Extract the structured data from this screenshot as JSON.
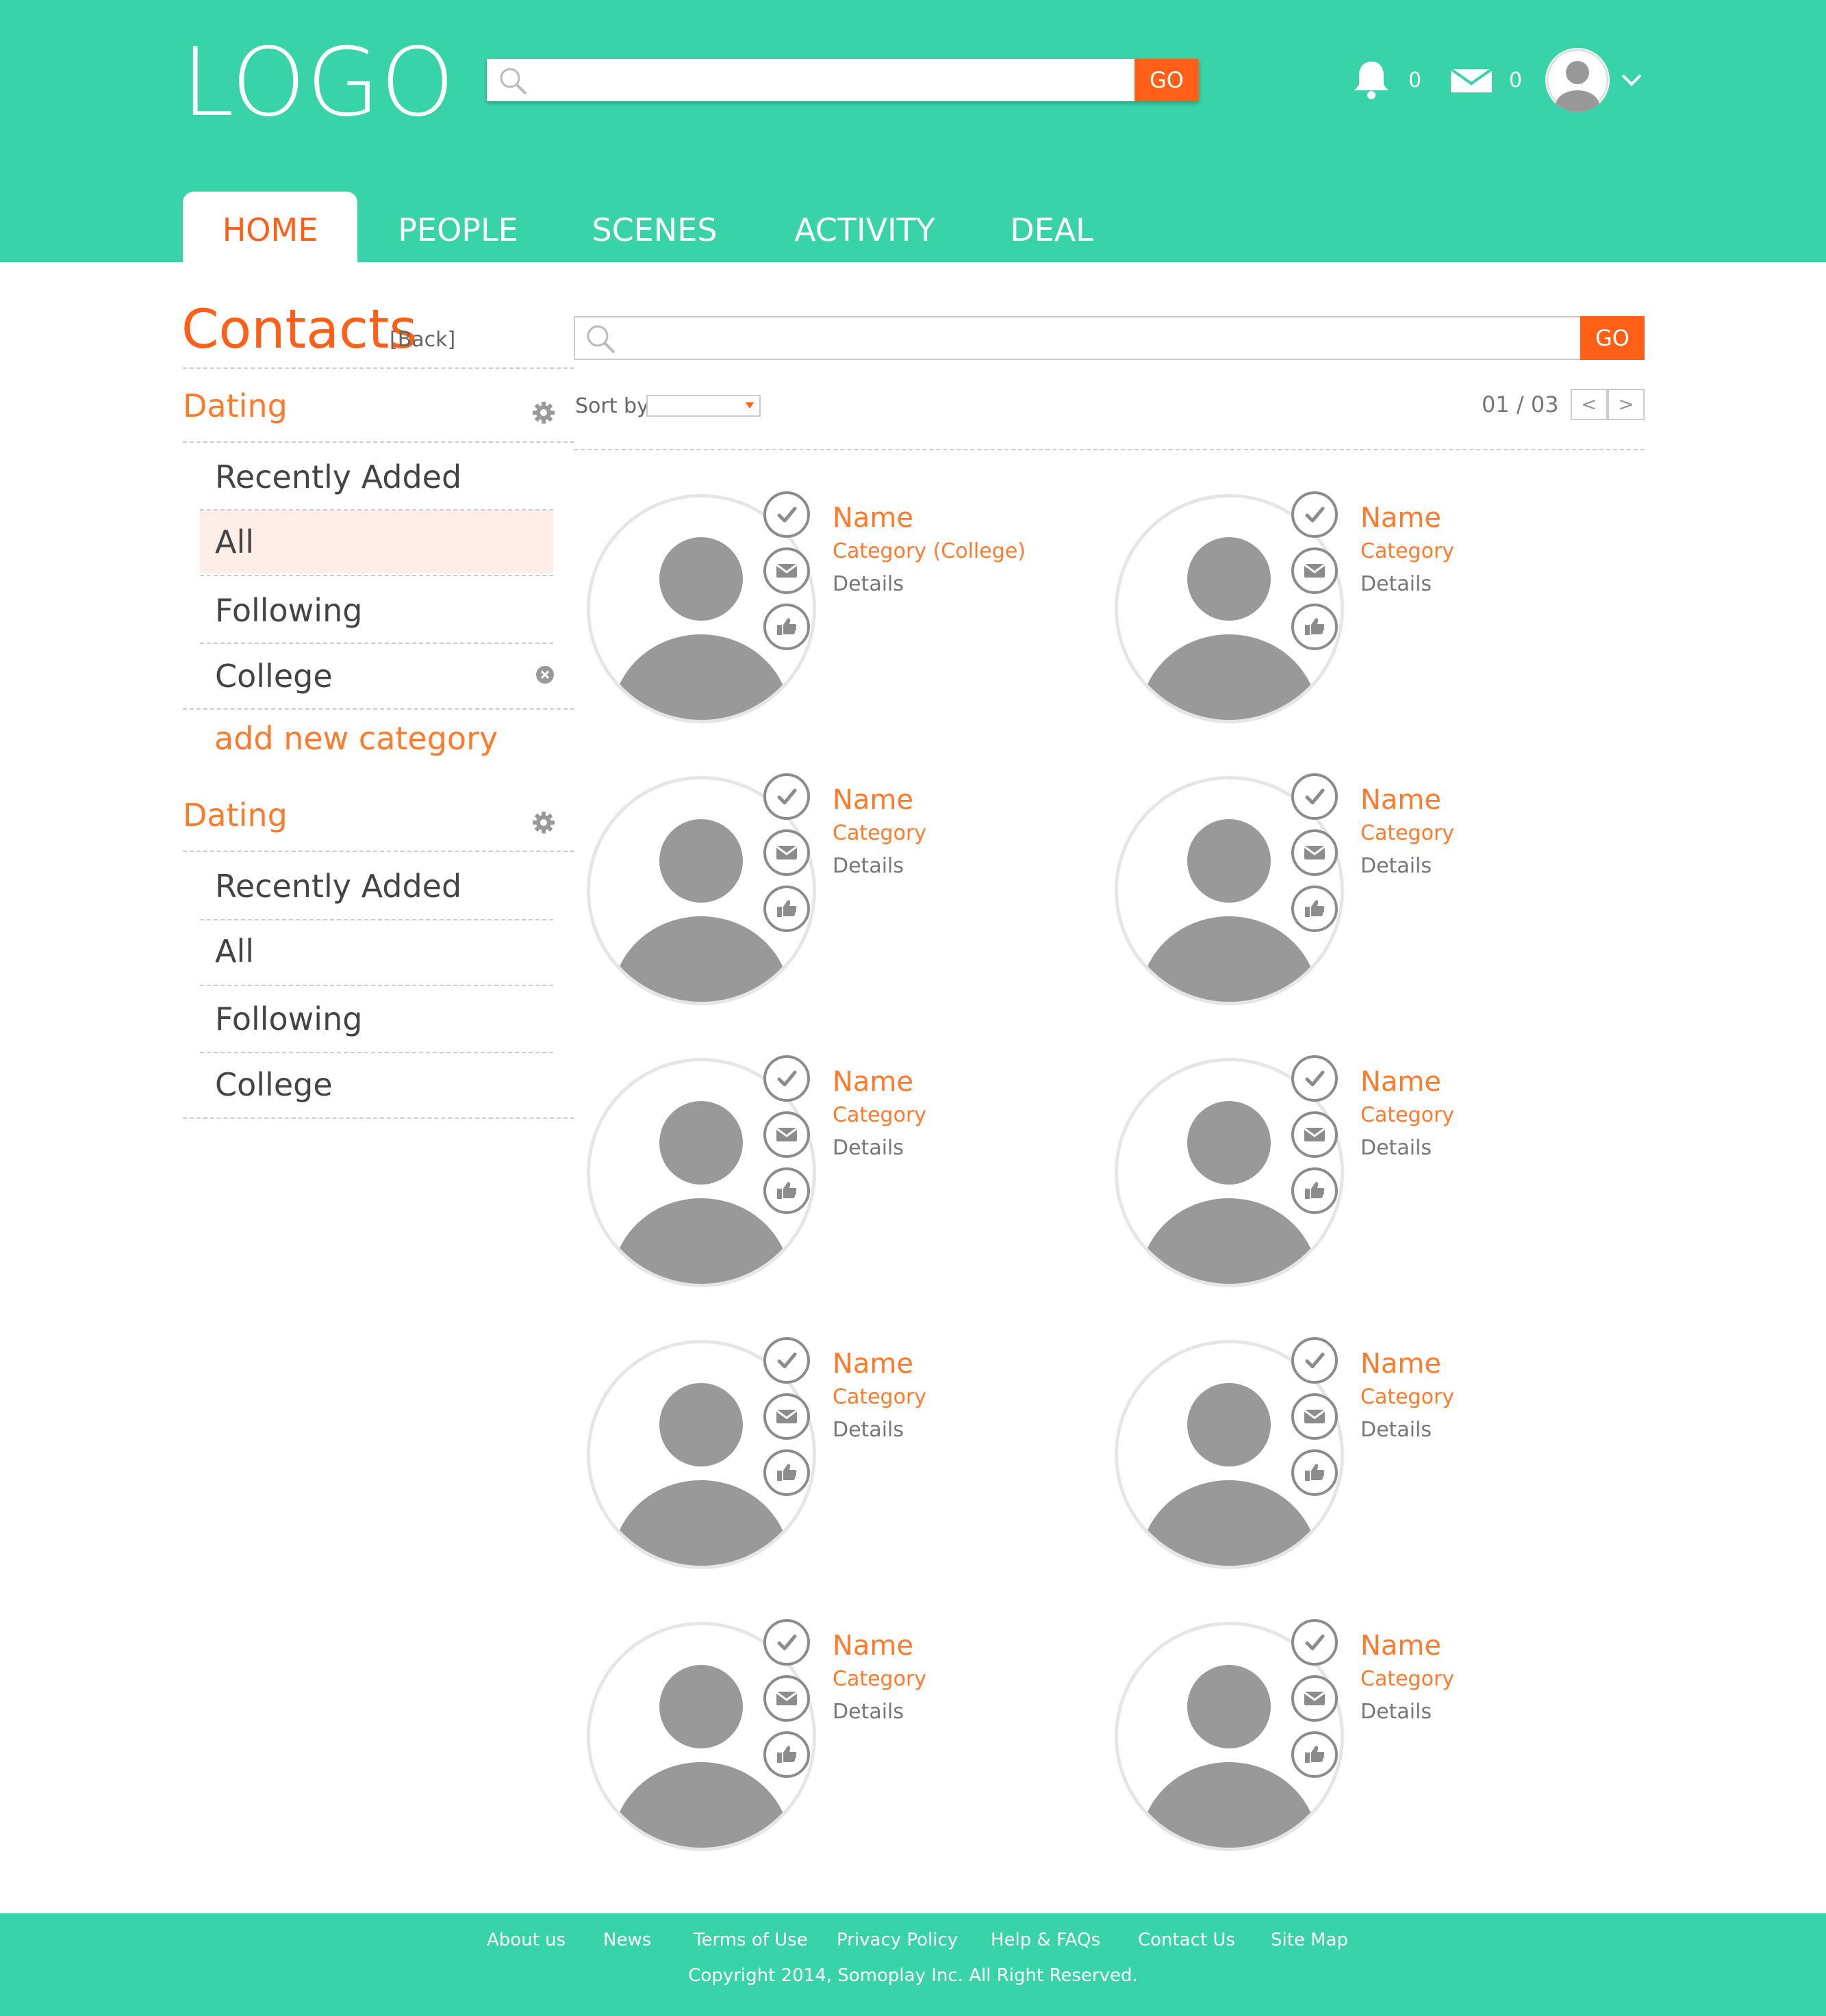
{
  "header": {
    "logo": "LOGO",
    "search_placeholder": "",
    "search_go": "GO",
    "notifications_count": "0",
    "messages_count": "0"
  },
  "nav": {
    "tabs": [
      {
        "label": "HOME",
        "active": true
      },
      {
        "label": "PEOPLE"
      },
      {
        "label": "SCENES"
      },
      {
        "label": "ACTIVITY"
      },
      {
        "label": "DEAL"
      }
    ]
  },
  "sidebar": {
    "title": "Contacts",
    "back": "[Back]",
    "groups": [
      {
        "title": "Dating",
        "items": [
          "Recently Added",
          "All",
          "Following",
          "College"
        ],
        "selected": "All"
      },
      {
        "title": "Dating",
        "items": [
          "Recently Added",
          "All",
          "Following",
          "College"
        ]
      }
    ],
    "add_category": "add new category"
  },
  "main": {
    "search_placeholder": "",
    "search_go": "GO",
    "sort_label": "Sort by:",
    "sort_value": "",
    "pager": {
      "text": "01 / 03",
      "prev": "<",
      "next": ">"
    }
  },
  "contacts": [
    {
      "name": "Name",
      "category": "Category (College)",
      "details": "Details"
    },
    {
      "name": "Name",
      "category": "Category",
      "details": "Details"
    },
    {
      "name": "Name",
      "category": "Category",
      "details": "Details"
    },
    {
      "name": "Name",
      "category": "Category",
      "details": "Details"
    },
    {
      "name": "Name",
      "category": "Category",
      "details": "Details"
    },
    {
      "name": "Name",
      "category": "Category",
      "details": "Details"
    },
    {
      "name": "Name",
      "category": "Category",
      "details": "Details"
    },
    {
      "name": "Name",
      "category": "Category",
      "details": "Details"
    },
    {
      "name": "Name",
      "category": "Category",
      "details": "Details"
    },
    {
      "name": "Name",
      "category": "Category",
      "details": "Details"
    }
  ],
  "footer": {
    "links": [
      "About us",
      "News",
      "Terms of Use",
      "Privacy Policy",
      "Help & FAQs",
      "Contact Us",
      "Site Map"
    ],
    "copyright": "Copyright 2014, Somoplay Inc. All Right Reserved."
  },
  "colors": {
    "brand": "#38d3a9",
    "accent": "#ff5f17",
    "accent_text": "#ff7a2b",
    "selected_bg": "#ffeee7",
    "icon_gray": "#999999"
  },
  "icons": [
    "search-icon",
    "bell-icon",
    "envelope-icon",
    "user-icon",
    "chevron-down-icon",
    "gear-icon",
    "close-circle-icon",
    "check-icon",
    "mail-icon",
    "thumbs-up-icon"
  ]
}
